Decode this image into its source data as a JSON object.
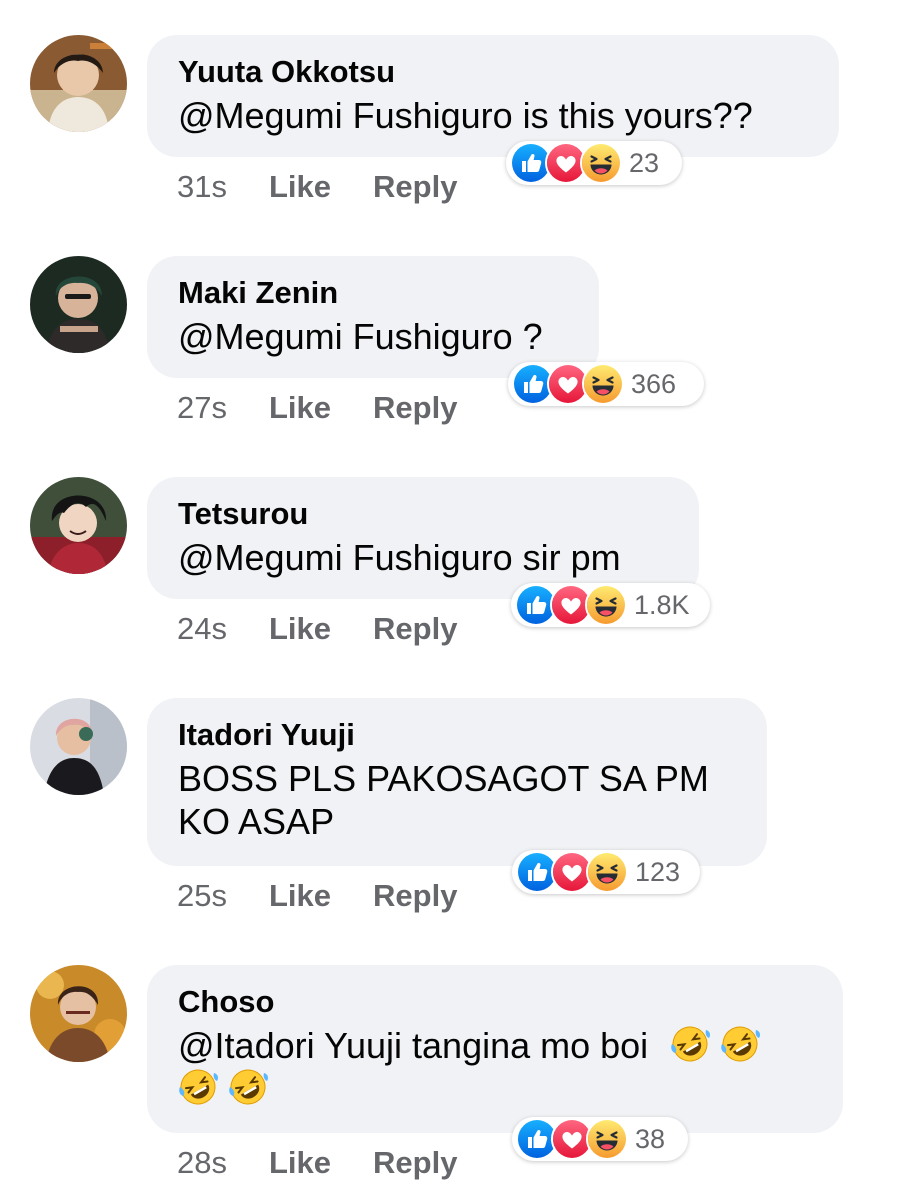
{
  "comments": [
    {
      "author": "Yuuta Okkotsu",
      "text": "@Megumi Fushiguro is this yours??",
      "time": "31s",
      "like_label": "Like",
      "reply_label": "Reply",
      "reaction_count": "23",
      "reactions": [
        "like-icon",
        "love-icon",
        "haha-icon"
      ]
    },
    {
      "author": "Maki Zenin",
      "text": "@Megumi Fushiguro ?",
      "time": "27s",
      "like_label": "Like",
      "reply_label": "Reply",
      "reaction_count": "366",
      "reactions": [
        "like-icon",
        "love-icon",
        "haha-icon"
      ]
    },
    {
      "author": "Tetsurou",
      "text": "@Megumi Fushiguro sir pm",
      "time": "24s",
      "like_label": "Like",
      "reply_label": "Reply",
      "reaction_count": "1.8K",
      "reactions": [
        "like-icon",
        "love-icon",
        "haha-icon"
      ]
    },
    {
      "author": "Itadori Yuuji",
      "text_line1": "BOSS PLS PAKOSAGOT SA PM",
      "text_line2": "KO ASAP",
      "time": "25s",
      "like_label": "Like",
      "reply_label": "Reply",
      "reaction_count": "123",
      "reactions": [
        "like-icon",
        "love-icon",
        "haha-icon"
      ]
    },
    {
      "author": "Choso",
      "text": "@Itadori Yuuji tangina mo boi",
      "emoji": "rolling-on-floor-laughing-emoji",
      "emoji_count": 4,
      "time": "28s",
      "like_label": "Like",
      "reply_label": "Reply",
      "reaction_count": "38",
      "reactions": [
        "like-icon",
        "love-icon",
        "haha-icon"
      ]
    }
  ],
  "colors": {
    "bubble": "#f0f2f5",
    "meta_text": "#65676b",
    "like_blue": "#1877f2",
    "love_red": "#f33e58",
    "haha_yellow": "#f7b125"
  }
}
